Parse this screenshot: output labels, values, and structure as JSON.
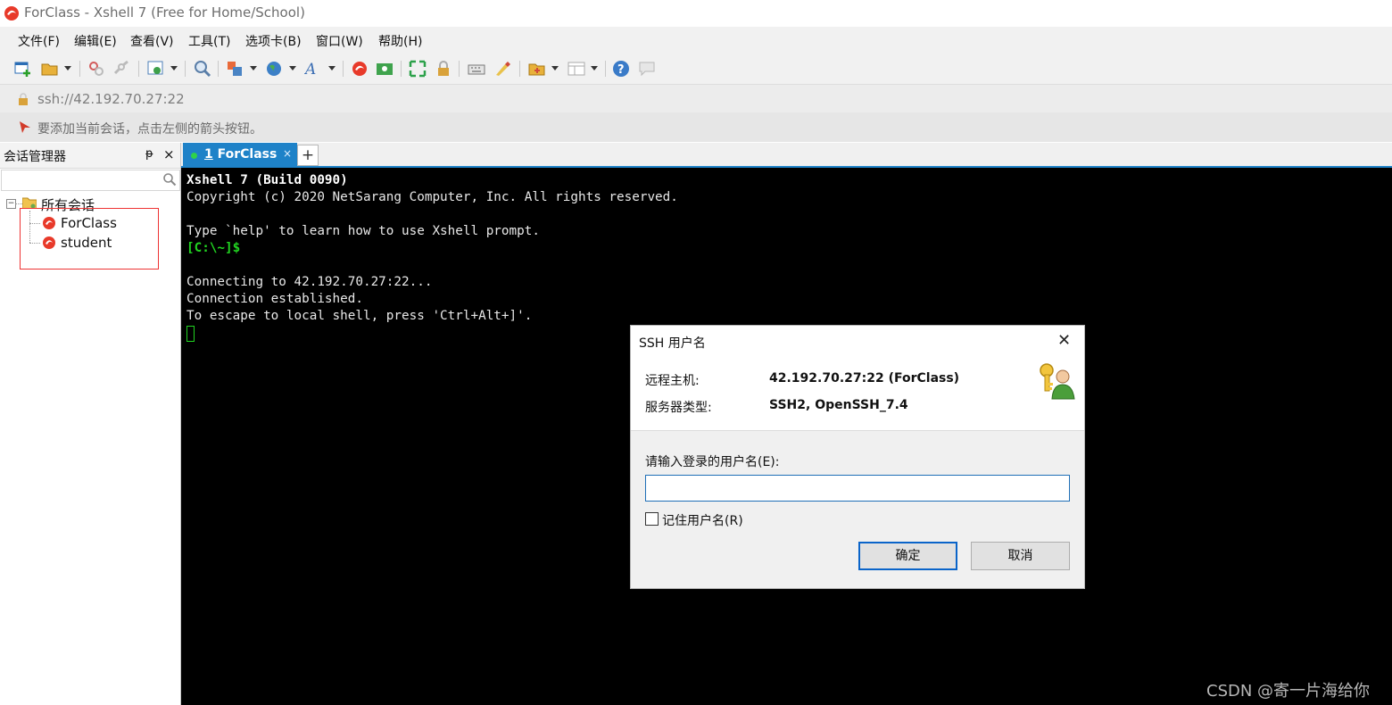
{
  "window": {
    "title": "ForClass - Xshell 7 (Free for Home/School)"
  },
  "menu": [
    "文件(F)",
    "编辑(E)",
    "查看(V)",
    "工具(T)",
    "选项卡(B)",
    "窗口(W)",
    "帮助(H)"
  ],
  "address": {
    "value": "ssh://42.192.70.27:22"
  },
  "hint": {
    "text": "要添加当前会话，点击左侧的箭头按钮。"
  },
  "session_manager": {
    "title": "会话管理器",
    "pin": "ᵽ",
    "close": "×",
    "search_value": "",
    "root": "所有会话",
    "sessions": [
      "ForClass",
      "student"
    ]
  },
  "tabs": {
    "items": [
      {
        "number": "1",
        "name": "ForClass",
        "close": "×"
      }
    ],
    "new_tab": "+"
  },
  "terminal": {
    "lines": [
      "Xshell 7 (Build 0090)",
      "Copyright (c) 2020 NetSarang Computer, Inc. All rights reserved.",
      "",
      "Type `help' to learn how to use Xshell prompt.",
      "[C:\\~]$",
      "",
      "Connecting to 42.192.70.27:22...",
      "Connection established.",
      "To escape to local shell, press 'Ctrl+Alt+]'."
    ]
  },
  "dialog": {
    "title": "SSH 用户名",
    "close": "✕",
    "host_label": "远程主机:",
    "host_value": "42.192.70.27:22 (ForClass)",
    "server_label": "服务器类型:",
    "server_value": "SSH2, OpenSSH_7.4",
    "prompt": "请输入登录的用户名(E):",
    "username_value": "",
    "remember_label": "记住用户名(R)",
    "remember_checked": false,
    "ok_label": "确定",
    "cancel_label": "取消"
  },
  "watermark": "CSDN @寄一片海给你",
  "colors": {
    "accent": "#1e82c8",
    "terminal_bg": "#000000",
    "prompt_green": "#21d421",
    "highlight_box": "#ee3333"
  }
}
